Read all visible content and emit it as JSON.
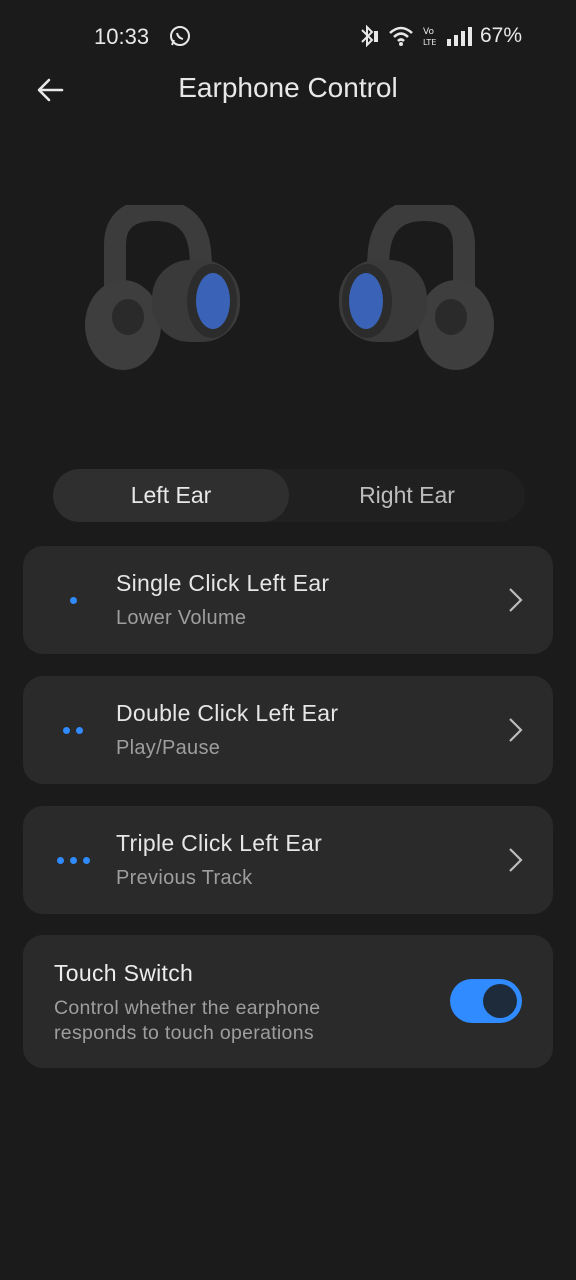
{
  "status_bar": {
    "time": "10:33",
    "battery": "67%",
    "icons": [
      "whatsapp-icon",
      "bluetooth-icon",
      "wifi-icon",
      "volte-icon",
      "signal-icon"
    ]
  },
  "header": {
    "title": "Earphone Control",
    "back_icon": "arrow-left-icon"
  },
  "tabs": [
    {
      "label": "Left Ear",
      "active": true
    },
    {
      "label": "Right Ear",
      "active": false
    }
  ],
  "actions": [
    {
      "title": "Single Click Left Ear",
      "value": "Lower Volume",
      "dots": 1
    },
    {
      "title": "Double Click Left Ear",
      "value": "Play/Pause",
      "dots": 2
    },
    {
      "title": "Triple Click Left Ear",
      "value": "Previous Track",
      "dots": 3
    }
  ],
  "touch_switch": {
    "title": "Touch Switch",
    "description": "Control whether the earphone responds to touch operations",
    "enabled": true
  },
  "colors": {
    "background": "#1b1b1b",
    "card": "#2a2a2a",
    "accent": "#2f8bff"
  }
}
